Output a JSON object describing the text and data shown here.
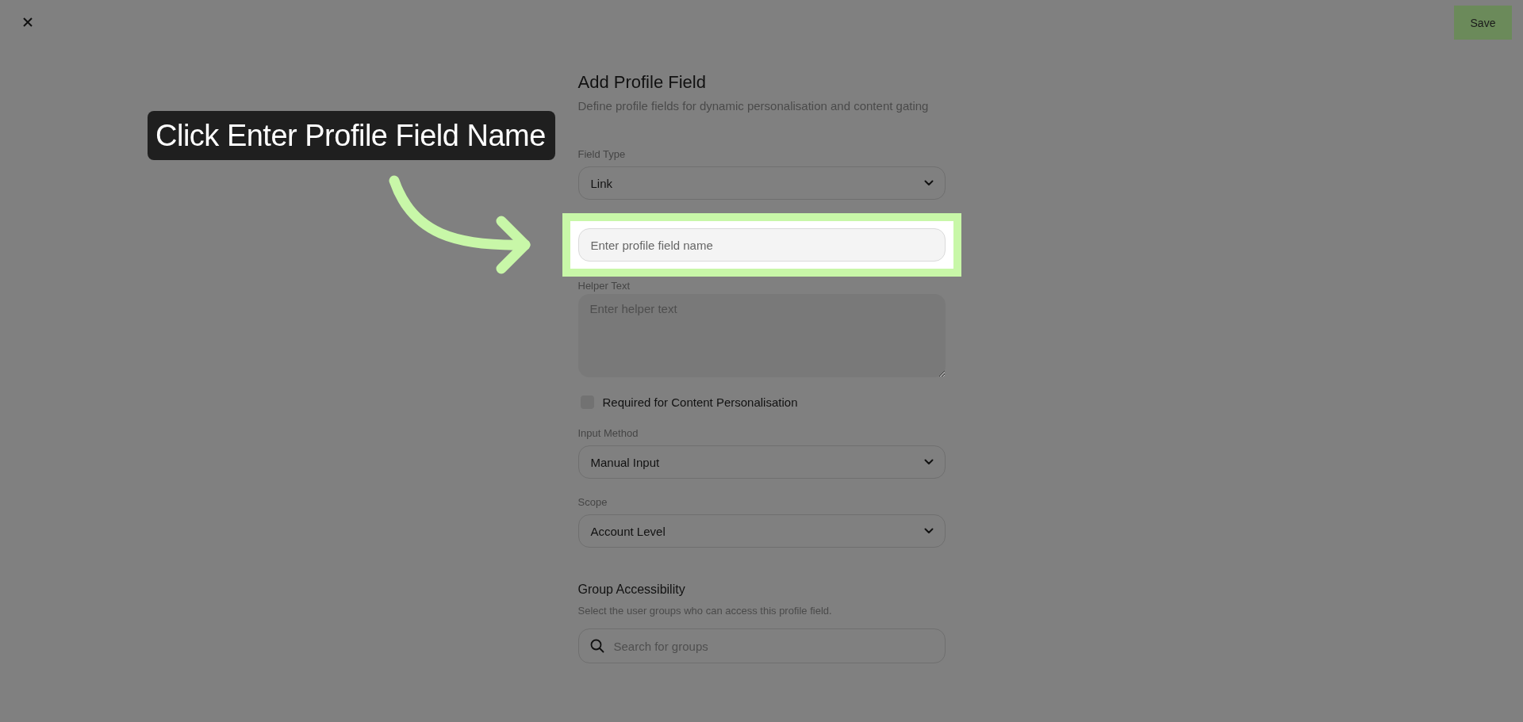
{
  "topbar": {
    "save_label": "Save"
  },
  "form": {
    "title": "Add Profile Field",
    "subtitle": "Define profile fields for dynamic personalisation and content gating",
    "fields": [
      {
        "kind": "select",
        "label": "Field Type",
        "value": "Link",
        "highlighted": false
      },
      {
        "kind": "text",
        "placeholder": "Enter profile field name",
        "highlighted": true
      },
      {
        "kind": "textarea",
        "label": "Helper Text",
        "placeholder": "Enter helper text",
        "highlighted": false
      },
      {
        "kind": "checkbox",
        "label": "Required for Content Personalisation",
        "checked": false,
        "highlighted": false
      },
      {
        "kind": "select",
        "label": "Input Method",
        "value": "Manual Input",
        "highlighted": false
      },
      {
        "kind": "select",
        "label": "Scope",
        "value": "Account Level",
        "highlighted": false
      }
    ],
    "group_access": {
      "title": "Group Accessibility",
      "description": "Select the user groups who can access this profile field.",
      "search": {
        "placeholder": "Search for groups"
      }
    }
  },
  "guide": {
    "tooltip": "Click Enter Profile Field Name"
  }
}
